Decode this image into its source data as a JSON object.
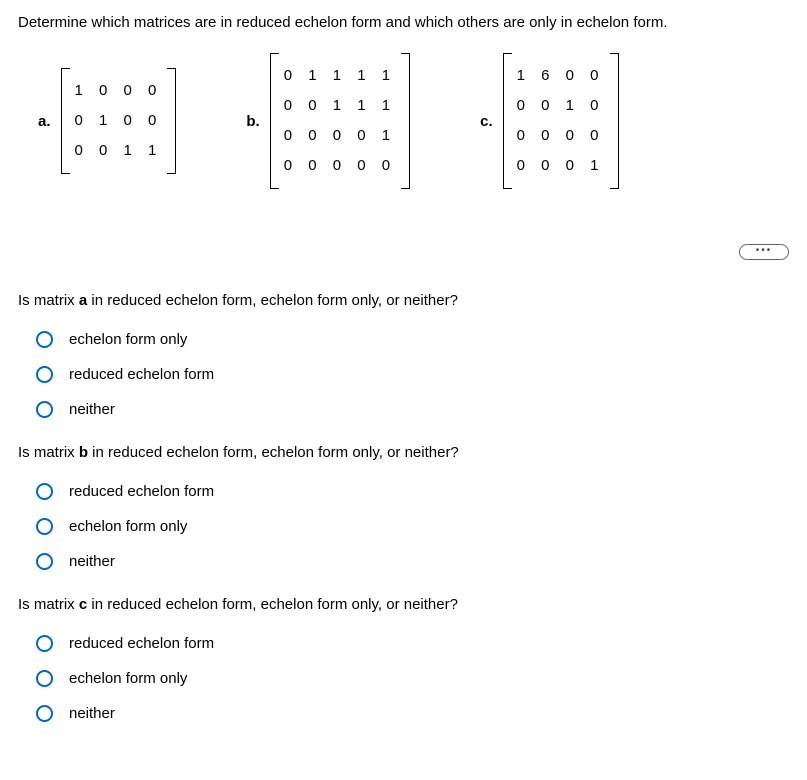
{
  "title": "Determine which matrices are in reduced echelon form and which others are only in echelon form.",
  "matrices": {
    "a": {
      "label": "a.",
      "rows": [
        "1 0 0 0",
        "0 1 0 0",
        "0 0 1 1"
      ]
    },
    "b": {
      "label": "b.",
      "rows": [
        "0 1 1 1 1",
        "0 0 1 1 1",
        "0 0 0 0 1",
        "0 0 0 0 0"
      ]
    },
    "c": {
      "label": "c.",
      "rows": [
        "1 6 0 0",
        "0 0 1 0",
        "0 0 0 0",
        "0 0 0 1"
      ]
    }
  },
  "questions": {
    "a": {
      "prefix": "Is matrix ",
      "bold": "a",
      "suffix": " in reduced echelon form, echelon form only, or neither?",
      "options": [
        "echelon form only",
        "reduced echelon form",
        "neither"
      ]
    },
    "b": {
      "prefix": "Is matrix ",
      "bold": "b",
      "suffix": " in reduced echelon form, echelon form only, or neither?",
      "options": [
        "reduced echelon form",
        "echelon form only",
        "neither"
      ]
    },
    "c": {
      "prefix": "Is matrix ",
      "bold": "c",
      "suffix": " in reduced echelon form, echelon form only, or neither?",
      "options": [
        "reduced echelon form",
        "echelon form only",
        "neither"
      ]
    }
  }
}
